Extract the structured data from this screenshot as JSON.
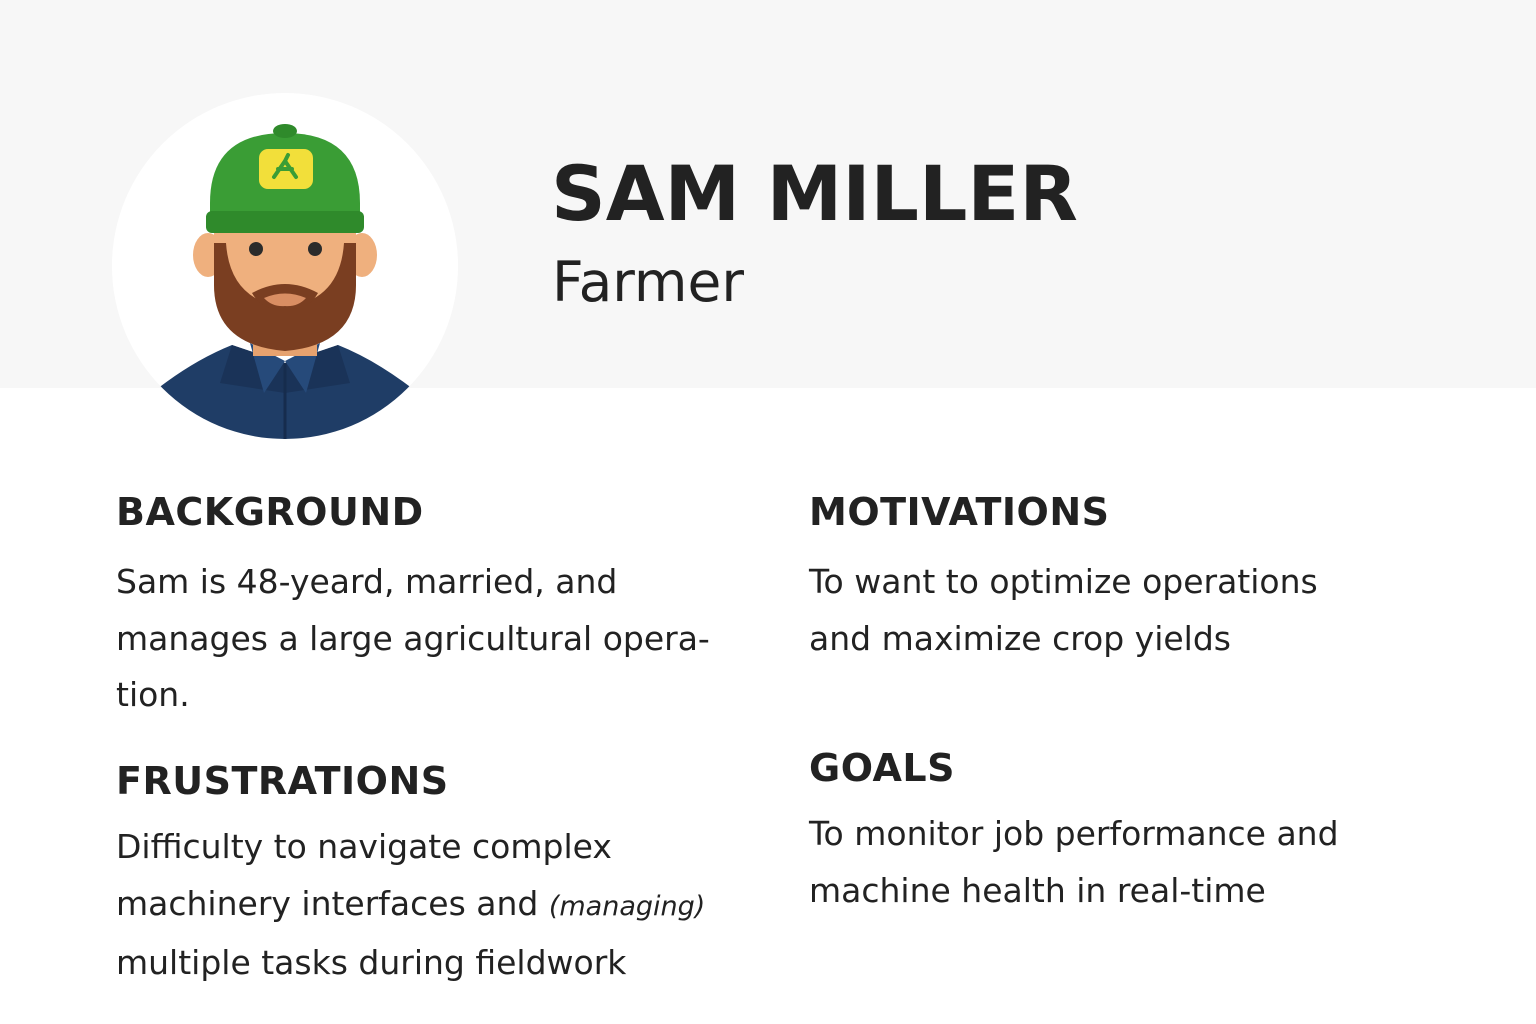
{
  "persona": {
    "name": "SAM MILLER",
    "role": "Farmer",
    "avatar_icon": "farmer-avatar-icon"
  },
  "sections": {
    "background": {
      "heading": "BACKGROUND",
      "lines": [
        "Sam is 48-yeard, married, and",
        "manages a large agricultural opera-",
        "tion."
      ]
    },
    "motivations": {
      "heading": "MOTIVATIONS",
      "lines": [
        "To want to optimize operations",
        "and maximize crop yields"
      ]
    },
    "frustrations": {
      "heading": "FRUSTRATIONS",
      "line1": "Difficulty to navigate complex",
      "line2_main": "machinery interfaces and ",
      "line2_note": "(managing)",
      "line3": "multiple tasks during fieldwork"
    },
    "goals": {
      "heading": "GOALS",
      "lines": [
        "To monitor job performance and",
        "machine health in real-time"
      ]
    }
  },
  "colors": {
    "header_background": "#f7f7f7",
    "cap_green": "#3a9d35",
    "cap_logo_yellow": "#f2df3a",
    "skin": "#efb07e",
    "beard": "#7a3e21",
    "shirt_navy": "#1f3d66",
    "text": "#222222"
  }
}
